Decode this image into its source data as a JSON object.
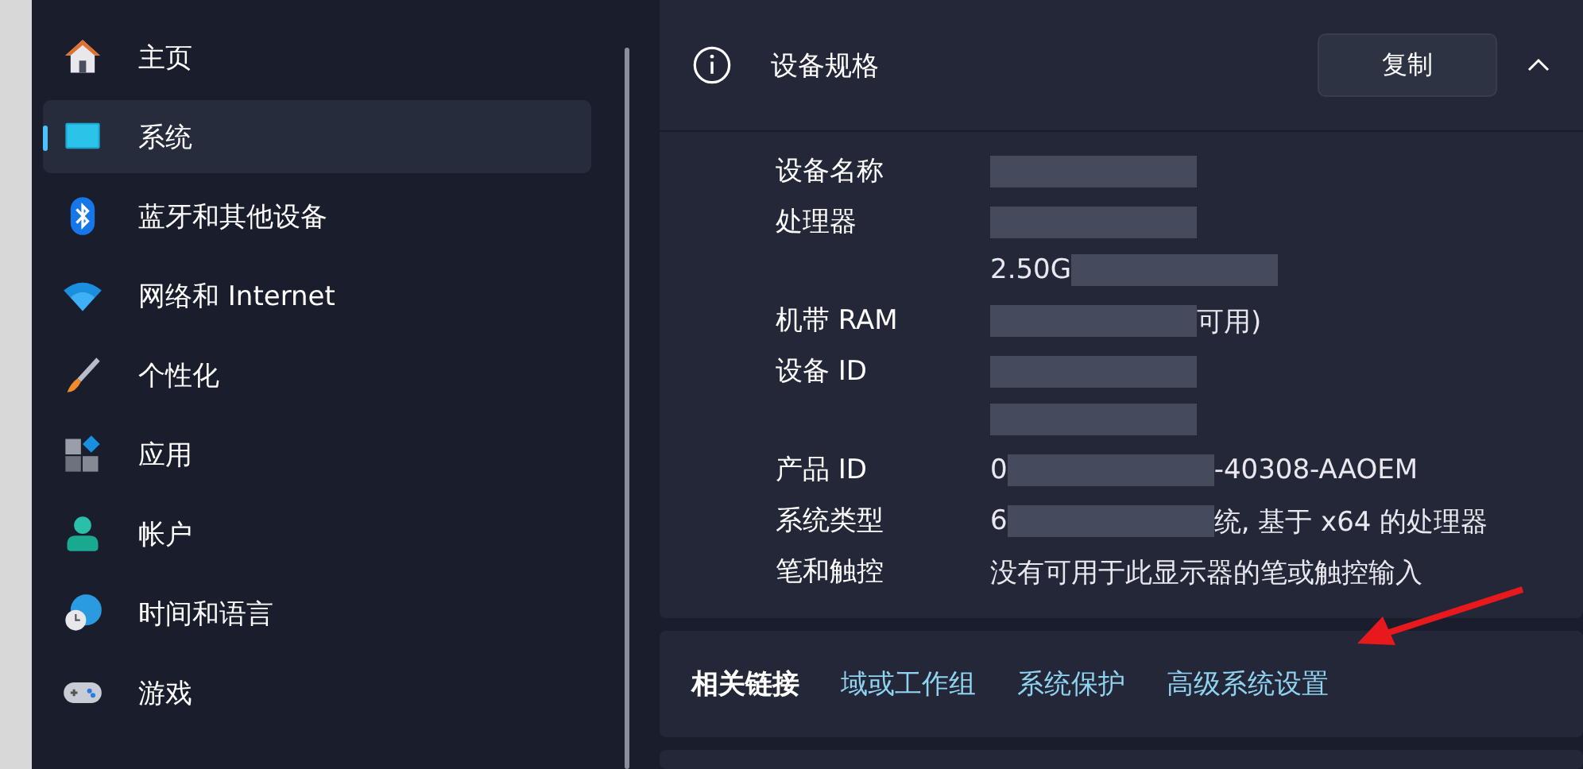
{
  "sidebar": {
    "items": [
      {
        "label": "主页",
        "selected": false
      },
      {
        "label": "系统",
        "selected": true
      },
      {
        "label": "蓝牙和其他设备",
        "selected": false
      },
      {
        "label": "网络和 Internet",
        "selected": false
      },
      {
        "label": "个性化",
        "selected": false
      },
      {
        "label": "应用",
        "selected": false
      },
      {
        "label": "帐户",
        "selected": false
      },
      {
        "label": "时间和语言",
        "selected": false
      },
      {
        "label": "游戏",
        "selected": false
      }
    ]
  },
  "specs": {
    "title": "设备规格",
    "copy_button": "复制",
    "expanded": true,
    "rows": [
      {
        "label": "设备名称",
        "lines": [
          [
            {
              "kind": "redacted"
            }
          ]
        ]
      },
      {
        "label": "处理器",
        "lines": [
          [
            {
              "kind": "redacted"
            }
          ],
          [
            {
              "kind": "text",
              "text": "2.50G"
            },
            {
              "kind": "redacted"
            }
          ]
        ]
      },
      {
        "label": "机带 RAM",
        "lines": [
          [
            {
              "kind": "redacted"
            },
            {
              "kind": "text",
              "text": "可用)"
            }
          ]
        ]
      },
      {
        "label": "设备 ID",
        "lines": [
          [
            {
              "kind": "redacted"
            }
          ],
          [
            {
              "kind": "redacted"
            }
          ]
        ]
      },
      {
        "label": "产品 ID",
        "lines": [
          [
            {
              "kind": "text",
              "text": "0"
            },
            {
              "kind": "redacted"
            },
            {
              "kind": "text",
              "text": "-40308-AAOEM"
            }
          ]
        ]
      },
      {
        "label": "系统类型",
        "lines": [
          [
            {
              "kind": "text",
              "text": "6"
            },
            {
              "kind": "redacted"
            },
            {
              "kind": "text",
              "text": "统, 基于 x64 的处理器"
            }
          ]
        ]
      },
      {
        "label": "笔和触控",
        "lines": [
          [
            {
              "kind": "text",
              "text": "没有可用于此显示器的笔或触控输入"
            }
          ]
        ]
      }
    ]
  },
  "related_links": {
    "title": "相关链接",
    "links": [
      "域或工作组",
      "系统保护",
      "高级系统设置"
    ]
  },
  "annotation": {
    "kind": "arrow"
  }
}
